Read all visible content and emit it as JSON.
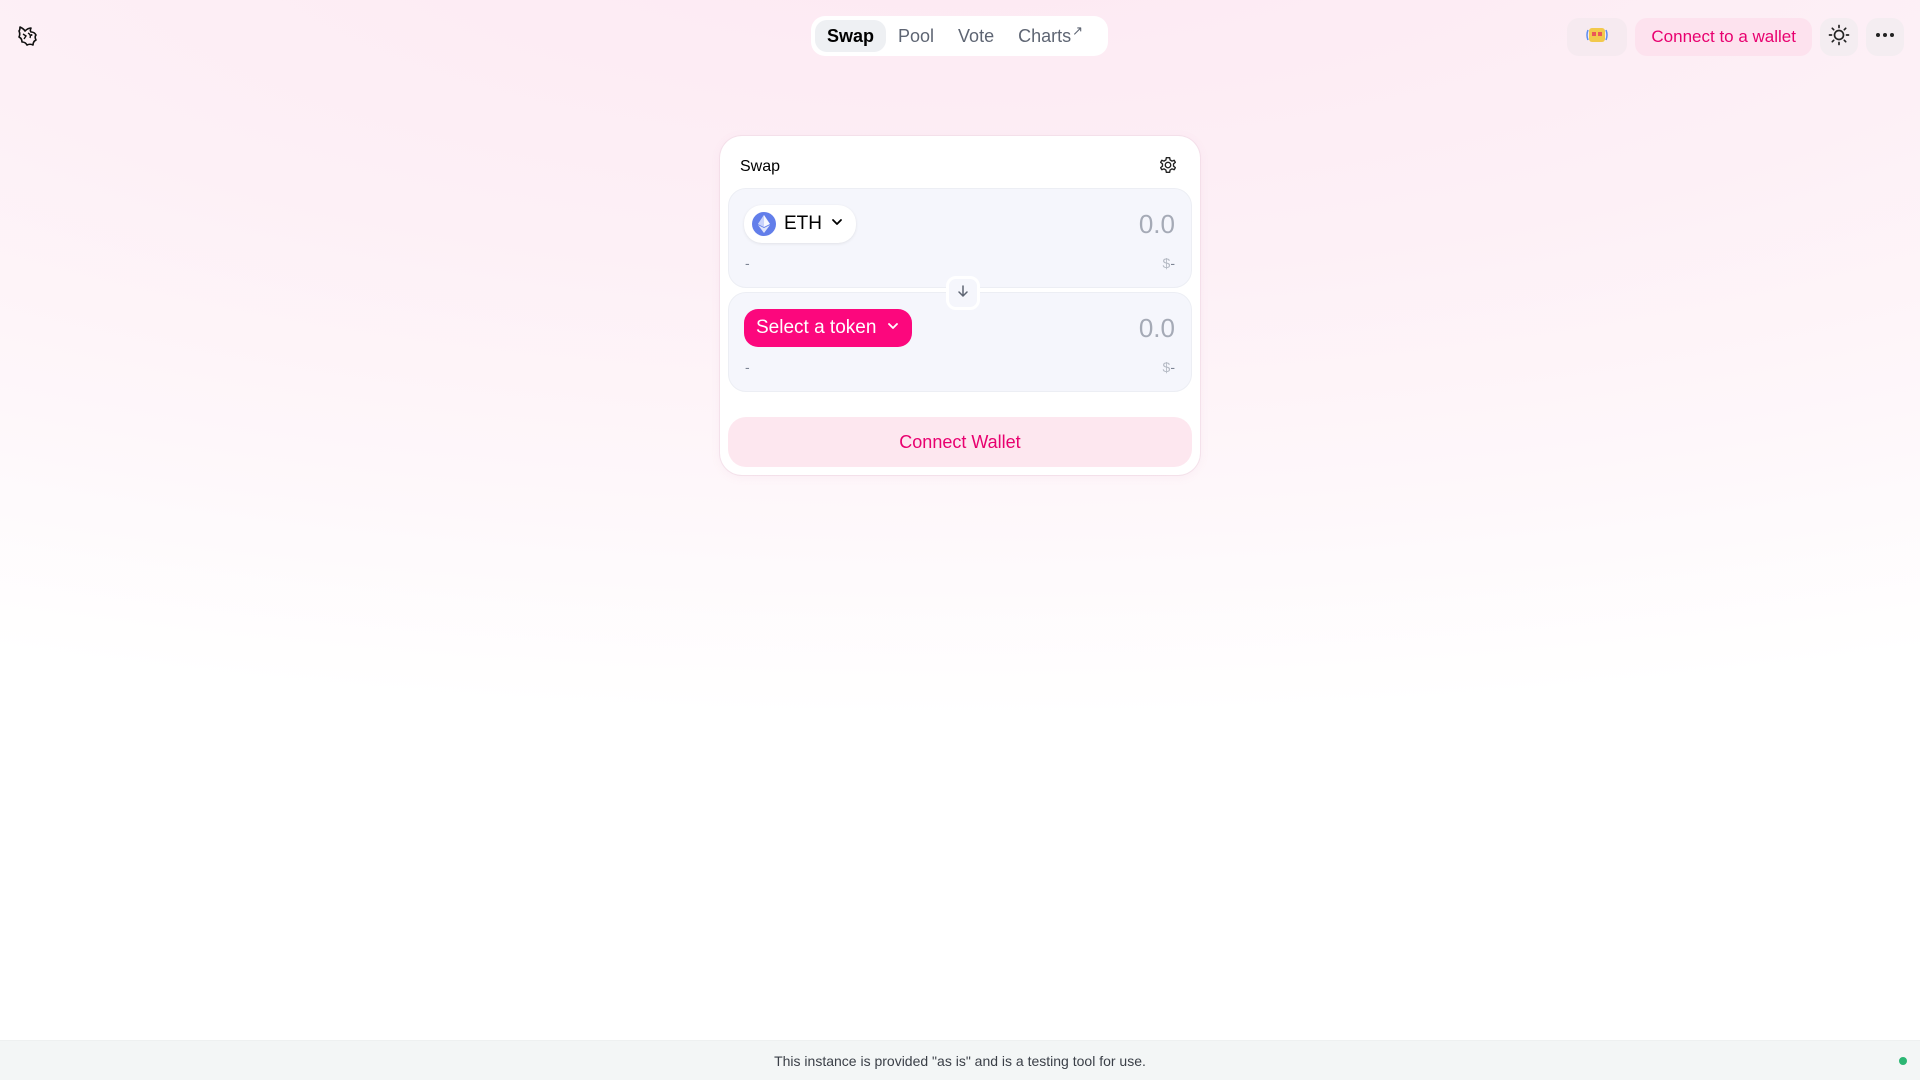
{
  "header": {
    "logo_icon": "uniswap-unicorn-icon",
    "nav": [
      {
        "label": "Swap",
        "active": true
      },
      {
        "label": "Pool",
        "active": false
      },
      {
        "label": "Vote",
        "active": false
      },
      {
        "label": "Charts",
        "active": false,
        "external": "↗"
      }
    ],
    "connect_label": "Connect to a wallet",
    "network_icon": "network-icon",
    "theme_icon": "sun-icon",
    "menu_icon": "more-dots-icon"
  },
  "swap": {
    "title": "Swap",
    "settings_icon": "gear-icon",
    "input": {
      "token": "ETH",
      "token_icon": "eth-icon",
      "amount_placeholder": "0.0",
      "balance": "-",
      "fiat_currency": "$",
      "fiat_value": "-"
    },
    "output": {
      "select_label": "Select a token",
      "amount_placeholder": "0.0",
      "balance": "-",
      "fiat_currency": "$",
      "fiat_value": "-"
    },
    "switch_icon": "arrow-down-icon",
    "connect_button": "Connect Wallet"
  },
  "footer": {
    "text": "This instance is provided \"as is\" and is a testing tool for use.",
    "status": "online"
  },
  "colors": {
    "accent": "#fc077d",
    "accent_text": "#e8006f",
    "accent_soft": "#fde7ef",
    "eth": "#627eea",
    "status_dot": "#2bb673"
  }
}
